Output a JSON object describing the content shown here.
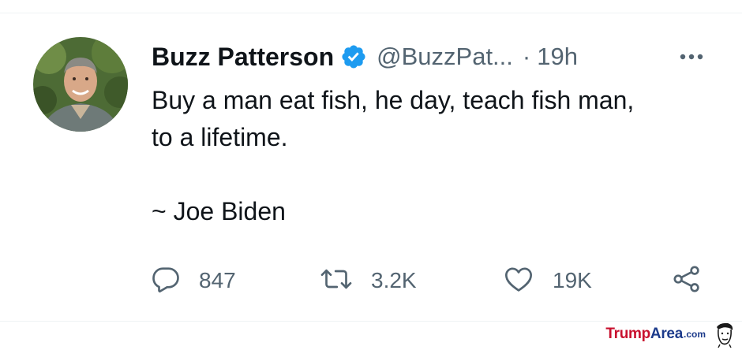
{
  "tweet": {
    "author_name": "Buzz Patterson",
    "handle": "@BuzzPat...",
    "separator": "·",
    "time": "19h",
    "text_lines": [
      "Buy a man eat fish, he day, teach fish man,",
      "to a lifetime.",
      "",
      "~ Joe Biden"
    ],
    "verified": true
  },
  "actions": {
    "reply_count": "847",
    "retweet_count": "3.2K",
    "like_count": "19K"
  },
  "icons": {
    "verified": "verified-badge-icon",
    "more": "more-options-icon",
    "reply": "reply-icon",
    "retweet": "retweet-icon",
    "like": "heart-icon",
    "share": "share-icon"
  },
  "colors": {
    "verified_blue": "#1d9bf0",
    "text_primary": "#0f1419",
    "text_secondary": "#536471",
    "watermark_red": "#c8102e",
    "watermark_blue": "#1d3b8b"
  },
  "watermark": {
    "part1": "Trump",
    "part2": "Area",
    "suffix": ".com"
  }
}
